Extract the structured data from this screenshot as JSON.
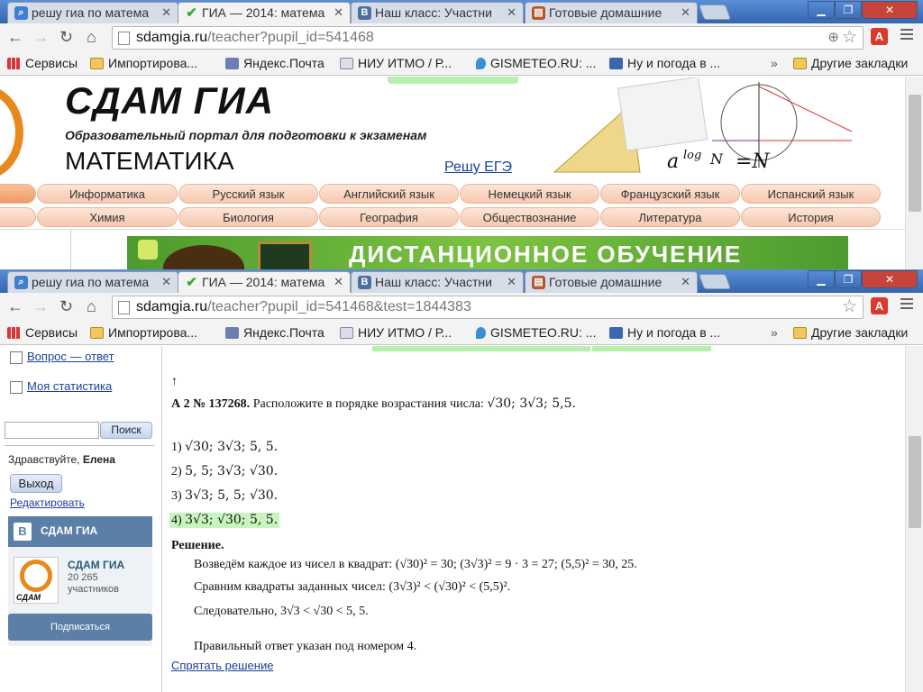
{
  "windows": [
    {
      "tabs": [
        {
          "label": "решу гиа по матема",
          "icon": "search-favicon",
          "color": "#3f7fd0"
        },
        {
          "label": "ГИА — 2014: матема",
          "icon": "checkmark-favicon",
          "color": "#3aaa35"
        },
        {
          "label": "Наш класс: Участни",
          "icon": "vk-favicon",
          "color": "#4d6f9e"
        },
        {
          "label": "Готовые домашние",
          "icon": "books-favicon",
          "color": "#b5562a"
        }
      ],
      "url": {
        "host": "sdamgia.ru",
        "path": "/teacher?pupil_id=541468"
      }
    },
    {
      "tabs": [
        {
          "label": "решу гиа по матема",
          "icon": "search-favicon",
          "color": "#3f7fd0"
        },
        {
          "label": "ГИА — 2014: матема",
          "icon": "checkmark-favicon",
          "color": "#3aaa35"
        },
        {
          "label": "Наш класс: Участни",
          "icon": "vk-favicon",
          "color": "#4d6f9e"
        },
        {
          "label": "Готовые домашние",
          "icon": "books-favicon",
          "color": "#b5562a"
        }
      ],
      "url": {
        "host": "sdamgia.ru",
        "path": "/teacher?pupil_id=541468&test=1844383"
      }
    }
  ],
  "bookmarks": [
    {
      "label": "Сервисы",
      "icon": "apps-icon"
    },
    {
      "label": "Импортирова...",
      "icon": "folder-icon"
    },
    {
      "label": "Яндекс.Почта",
      "icon": "mail-icon"
    },
    {
      "label": "НИУ ИТМО / Р...",
      "icon": "itmo-icon"
    },
    {
      "label": "GISMETEO.RU: ...",
      "icon": "drop-icon"
    },
    {
      "label": "Ну и погода в ...",
      "icon": "weather-icon"
    },
    {
      "label": "»",
      "icon": "more-icon"
    },
    {
      "label": "Другие закладки",
      "icon": "folder-icon"
    }
  ],
  "site": {
    "title": "СДАМ ГИА",
    "subtitle": "Образовательный портал для подготовки к экзаменам",
    "subject": "МАТЕМАТИКА",
    "ege_link": "Решу ЕГЭ",
    "banner": "ДИСТАНЦИОННОЕ ОБУЧЕНИЕ",
    "subjects_row1": [
      "Информатика",
      "Русский язык",
      "Английский язык",
      "Немецкий язык",
      "Французский язык",
      "Испанский язык"
    ],
    "subjects_row2": [
      "Химия",
      "Биология",
      "География",
      "Обществознание",
      "Литература",
      "История"
    ]
  },
  "sidebar": {
    "links": [
      "Вопрос — ответ",
      "Моя статистика"
    ],
    "search_button": "Поиск",
    "greeting": "Здравствуйте,",
    "user": "Елена",
    "logout": "Выход",
    "edit": "Редактировать",
    "vk": {
      "header": "СДАМ ГИА",
      "name": "СДАМ ГИА",
      "count": "20 265",
      "members": "участников",
      "avatar_caption": "СДАМ ГИА",
      "subscribe": "Подписаться"
    }
  },
  "problem": {
    "arrow": "↑",
    "label": "А 2 № 137268.",
    "text": "Расположите в порядке возрастания числа:",
    "numbers": "√30; 3√3; 5,5.",
    "options": [
      {
        "num": "1)",
        "text": "√30; 3√3; 5, 5."
      },
      {
        "num": "2)",
        "text": "5, 5; 3√3; √30."
      },
      {
        "num": "3)",
        "text": "3√3; 5, 5; √30."
      },
      {
        "num": "4)",
        "text": "3√3; √30; 5, 5."
      }
    ],
    "correct_option": 4,
    "solution_label": "Решение.",
    "solution": [
      "Возведём каждое из чисел в квадрат: (√30)² = 30;  (3√3)² = 9 · 3 = 27;  (5,5)² = 30, 25.",
      "Сравним квадраты заданных чисел: (3√3)² < (√30)² < (5,5)².",
      "Следовательно, 3√3 < √30 < 5, 5.",
      "Правильный ответ указан под номером 4."
    ],
    "hide_link": "Спрятать решение"
  }
}
